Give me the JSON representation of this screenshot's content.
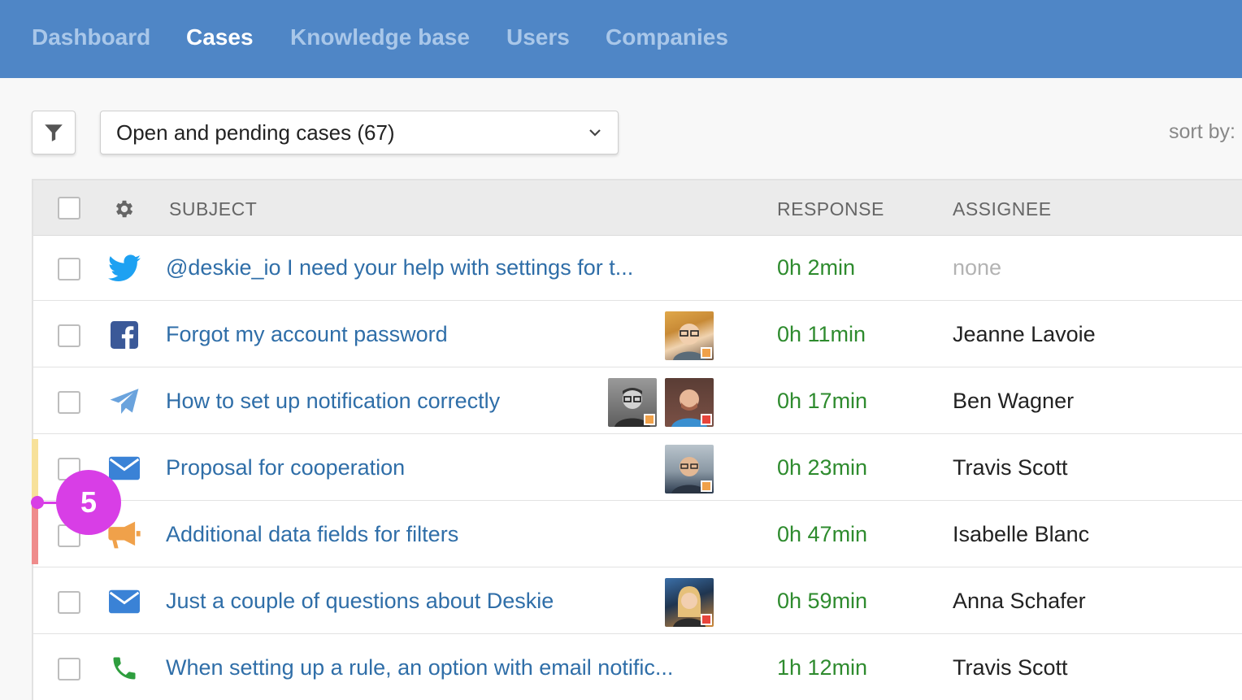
{
  "nav": {
    "items": [
      {
        "label": "Dashboard",
        "active": false
      },
      {
        "label": "Cases",
        "active": true
      },
      {
        "label": "Knowledge base",
        "active": false
      },
      {
        "label": "Users",
        "active": false
      },
      {
        "label": "Companies",
        "active": false
      }
    ]
  },
  "toolbar": {
    "filter_icon": "filter-icon",
    "view_select_value": "Open and pending cases (67)",
    "sort_label": "sort by:"
  },
  "table": {
    "headers": {
      "subject": "SUBJECT",
      "response": "RESPONSE",
      "assignee": "ASSIGNEE"
    },
    "rows": [
      {
        "channel": "twitter-icon",
        "subject": "@deskie_io I need your help with settings for t...",
        "response": "0h 2min",
        "assignee": "none",
        "priority": ""
      },
      {
        "channel": "facebook-icon",
        "subject": "Forgot my account password",
        "response": "0h 11min",
        "assignee": "Jeanne Lavoie",
        "priority": ""
      },
      {
        "channel": "telegram-icon",
        "subject": "How to set up notification correctly",
        "response": "0h 17min",
        "assignee": "Ben Wagner",
        "priority": ""
      },
      {
        "channel": "email-icon",
        "subject": "Proposal for cooperation",
        "response": "0h 23min",
        "assignee": "Travis Scott",
        "priority": "medium"
      },
      {
        "channel": "megaphone-icon",
        "subject": "Additional data fields for filters",
        "response": "0h 47min",
        "assignee": "Isabelle Blanc",
        "priority": "high"
      },
      {
        "channel": "email-icon",
        "subject": "Just a couple of questions about Deskie",
        "response": "0h 59min",
        "assignee": "Anna Schafer",
        "priority": ""
      },
      {
        "channel": "phone-icon",
        "subject": "When setting up a rule, an option with email notific...",
        "response": "1h 12min",
        "assignee": "Travis Scott",
        "priority": ""
      }
    ]
  },
  "callout": {
    "number": "5"
  },
  "colors": {
    "nav_bg": "#4f86c6",
    "link": "#2f6ea8",
    "response": "#2e8b2e",
    "callout": "#d83ee6",
    "priority_medium": "#f7e19a",
    "priority_high": "#ef8c8c",
    "status_orange": "#f0a14a",
    "status_red": "#e8453c"
  }
}
